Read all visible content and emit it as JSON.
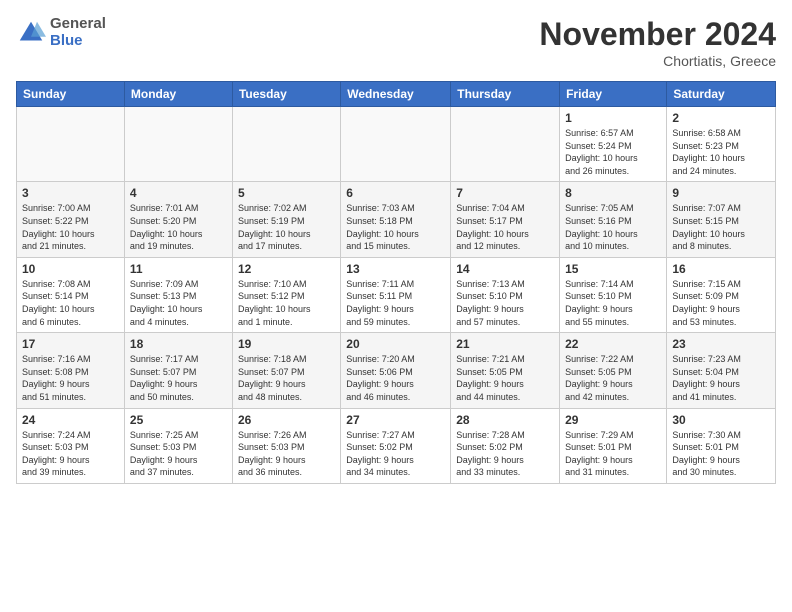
{
  "header": {
    "logo_general": "General",
    "logo_blue": "Blue",
    "month": "November 2024",
    "location": "Chortiatis, Greece"
  },
  "days_of_week": [
    "Sunday",
    "Monday",
    "Tuesday",
    "Wednesday",
    "Thursday",
    "Friday",
    "Saturday"
  ],
  "weeks": [
    {
      "days": [
        {
          "num": "",
          "info": "",
          "empty": true
        },
        {
          "num": "",
          "info": "",
          "empty": true
        },
        {
          "num": "",
          "info": "",
          "empty": true
        },
        {
          "num": "",
          "info": "",
          "empty": true
        },
        {
          "num": "",
          "info": "",
          "empty": true
        },
        {
          "num": "1",
          "info": "Sunrise: 6:57 AM\nSunset: 5:24 PM\nDaylight: 10 hours\nand 26 minutes."
        },
        {
          "num": "2",
          "info": "Sunrise: 6:58 AM\nSunset: 5:23 PM\nDaylight: 10 hours\nand 24 minutes."
        }
      ]
    },
    {
      "days": [
        {
          "num": "3",
          "info": "Sunrise: 7:00 AM\nSunset: 5:22 PM\nDaylight: 10 hours\nand 21 minutes."
        },
        {
          "num": "4",
          "info": "Sunrise: 7:01 AM\nSunset: 5:20 PM\nDaylight: 10 hours\nand 19 minutes."
        },
        {
          "num": "5",
          "info": "Sunrise: 7:02 AM\nSunset: 5:19 PM\nDaylight: 10 hours\nand 17 minutes."
        },
        {
          "num": "6",
          "info": "Sunrise: 7:03 AM\nSunset: 5:18 PM\nDaylight: 10 hours\nand 15 minutes."
        },
        {
          "num": "7",
          "info": "Sunrise: 7:04 AM\nSunset: 5:17 PM\nDaylight: 10 hours\nand 12 minutes."
        },
        {
          "num": "8",
          "info": "Sunrise: 7:05 AM\nSunset: 5:16 PM\nDaylight: 10 hours\nand 10 minutes."
        },
        {
          "num": "9",
          "info": "Sunrise: 7:07 AM\nSunset: 5:15 PM\nDaylight: 10 hours\nand 8 minutes."
        }
      ]
    },
    {
      "days": [
        {
          "num": "10",
          "info": "Sunrise: 7:08 AM\nSunset: 5:14 PM\nDaylight: 10 hours\nand 6 minutes."
        },
        {
          "num": "11",
          "info": "Sunrise: 7:09 AM\nSunset: 5:13 PM\nDaylight: 10 hours\nand 4 minutes."
        },
        {
          "num": "12",
          "info": "Sunrise: 7:10 AM\nSunset: 5:12 PM\nDaylight: 10 hours\nand 1 minute."
        },
        {
          "num": "13",
          "info": "Sunrise: 7:11 AM\nSunset: 5:11 PM\nDaylight: 9 hours\nand 59 minutes."
        },
        {
          "num": "14",
          "info": "Sunrise: 7:13 AM\nSunset: 5:10 PM\nDaylight: 9 hours\nand 57 minutes."
        },
        {
          "num": "15",
          "info": "Sunrise: 7:14 AM\nSunset: 5:10 PM\nDaylight: 9 hours\nand 55 minutes."
        },
        {
          "num": "16",
          "info": "Sunrise: 7:15 AM\nSunset: 5:09 PM\nDaylight: 9 hours\nand 53 minutes."
        }
      ]
    },
    {
      "days": [
        {
          "num": "17",
          "info": "Sunrise: 7:16 AM\nSunset: 5:08 PM\nDaylight: 9 hours\nand 51 minutes."
        },
        {
          "num": "18",
          "info": "Sunrise: 7:17 AM\nSunset: 5:07 PM\nDaylight: 9 hours\nand 50 minutes."
        },
        {
          "num": "19",
          "info": "Sunrise: 7:18 AM\nSunset: 5:07 PM\nDaylight: 9 hours\nand 48 minutes."
        },
        {
          "num": "20",
          "info": "Sunrise: 7:20 AM\nSunset: 5:06 PM\nDaylight: 9 hours\nand 46 minutes."
        },
        {
          "num": "21",
          "info": "Sunrise: 7:21 AM\nSunset: 5:05 PM\nDaylight: 9 hours\nand 44 minutes."
        },
        {
          "num": "22",
          "info": "Sunrise: 7:22 AM\nSunset: 5:05 PM\nDaylight: 9 hours\nand 42 minutes."
        },
        {
          "num": "23",
          "info": "Sunrise: 7:23 AM\nSunset: 5:04 PM\nDaylight: 9 hours\nand 41 minutes."
        }
      ]
    },
    {
      "days": [
        {
          "num": "24",
          "info": "Sunrise: 7:24 AM\nSunset: 5:03 PM\nDaylight: 9 hours\nand 39 minutes."
        },
        {
          "num": "25",
          "info": "Sunrise: 7:25 AM\nSunset: 5:03 PM\nDaylight: 9 hours\nand 37 minutes."
        },
        {
          "num": "26",
          "info": "Sunrise: 7:26 AM\nSunset: 5:03 PM\nDaylight: 9 hours\nand 36 minutes."
        },
        {
          "num": "27",
          "info": "Sunrise: 7:27 AM\nSunset: 5:02 PM\nDaylight: 9 hours\nand 34 minutes."
        },
        {
          "num": "28",
          "info": "Sunrise: 7:28 AM\nSunset: 5:02 PM\nDaylight: 9 hours\nand 33 minutes."
        },
        {
          "num": "29",
          "info": "Sunrise: 7:29 AM\nSunset: 5:01 PM\nDaylight: 9 hours\nand 31 minutes."
        },
        {
          "num": "30",
          "info": "Sunrise: 7:30 AM\nSunset: 5:01 PM\nDaylight: 9 hours\nand 30 minutes."
        }
      ]
    }
  ]
}
